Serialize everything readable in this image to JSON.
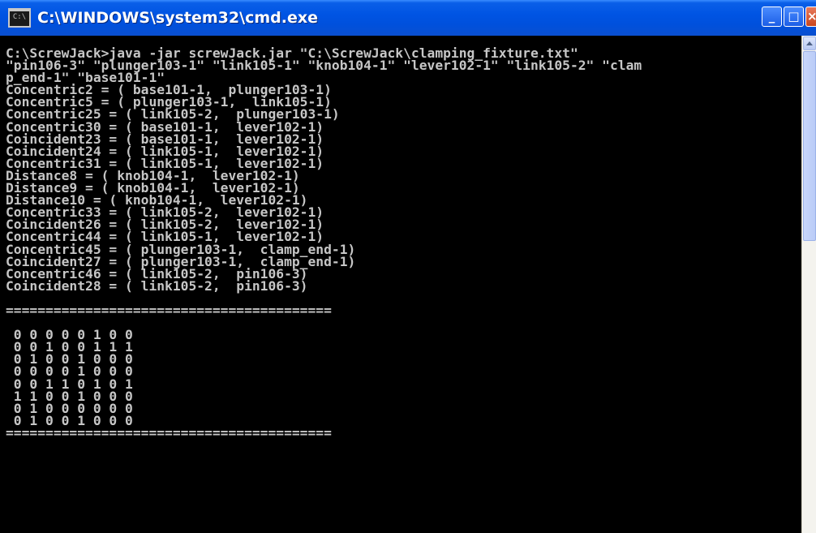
{
  "window": {
    "title": "C:\\WINDOWS\\system32\\cmd.exe",
    "icon_label": "C:\\",
    "controls": {
      "minimize": "_",
      "maximize": "□",
      "close": "×"
    }
  },
  "console": {
    "lines": [
      "C:\\ScrewJack>java -jar screwJack.jar \"C:\\ScrewJack\\clamping_fixture.txt\"",
      "\"pin106-3\" \"plunger103-1\" \"link105-1\" \"knob104-1\" \"lever102-1\" \"link105-2\" \"clam",
      "p_end-1\" \"base101-1\"",
      "Concentric2 = ( base101-1,  plunger103-1)",
      "Concentric5 = ( plunger103-1,  link105-1)",
      "Concentric25 = ( link105-2,  plunger103-1)",
      "Concentric30 = ( base101-1,  lever102-1)",
      "Coincident23 = ( base101-1,  lever102-1)",
      "Coincident24 = ( link105-1,  lever102-1)",
      "Concentric31 = ( link105-1,  lever102-1)",
      "Distance8 = ( knob104-1,  lever102-1)",
      "Distance9 = ( knob104-1,  lever102-1)",
      "Distance10 = ( knob104-1,  lever102-1)",
      "Concentric33 = ( link105-2,  lever102-1)",
      "Coincident26 = ( link105-2,  lever102-1)",
      "Concentric44 = ( link105-1,  lever102-1)",
      "Concentric45 = ( plunger103-1,  clamp_end-1)",
      "Coincident27 = ( plunger103-1,  clamp_end-1)",
      "Concentric46 = ( link105-2,  pin106-3)",
      "Coincident28 = ( link105-2,  pin106-3)",
      "",
      "=========================================",
      "",
      " 0 0 0 0 0 1 0 0",
      " 0 0 1 0 0 1 1 1",
      " 0 1 0 0 1 0 0 0",
      " 0 0 0 0 1 0 0 0",
      " 0 0 1 1 0 1 0 1",
      " 1 1 0 0 1 0 0 0",
      " 0 1 0 0 0 0 0 0",
      " 0 1 0 0 1 0 0 0",
      "========================================="
    ]
  }
}
